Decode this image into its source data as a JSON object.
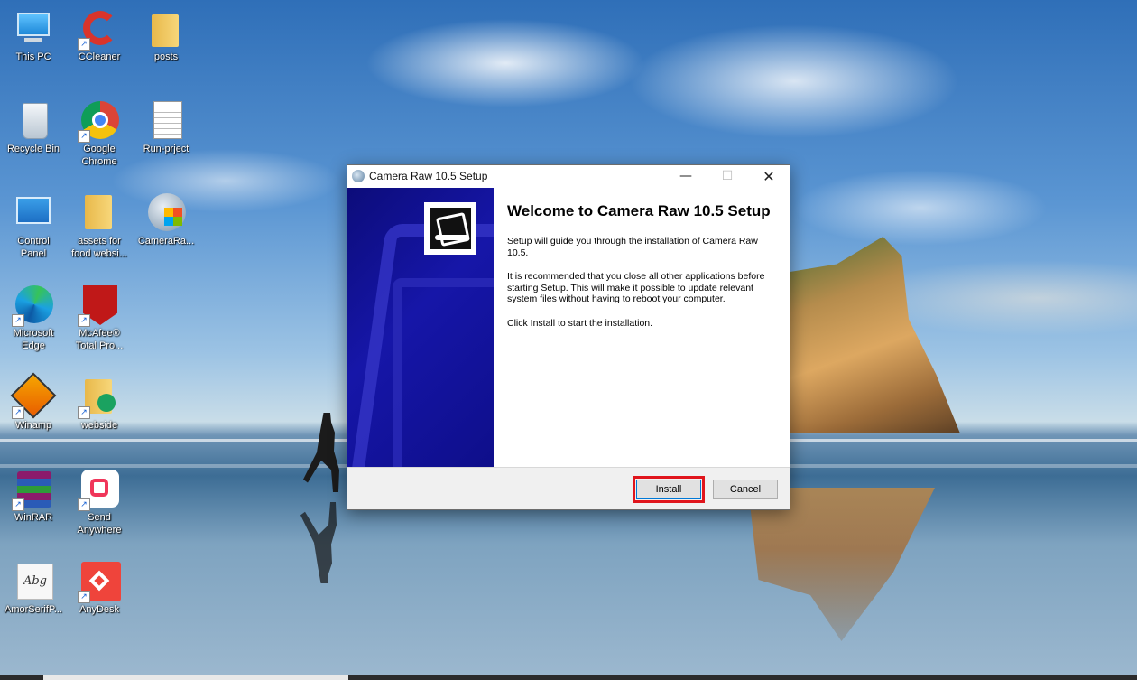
{
  "desktop": {
    "icons": [
      {
        "label": "This PC",
        "icon": "this-pc-icon"
      },
      {
        "label": "CCleaner",
        "icon": "ccleaner-icon"
      },
      {
        "label": "posts",
        "icon": "folder-icon"
      },
      {
        "label": "Recycle Bin",
        "icon": "recycle-bin-icon"
      },
      {
        "label": "Google\nChrome",
        "icon": "chrome-icon"
      },
      {
        "label": "Run-prject",
        "icon": "text-file-icon"
      },
      {
        "label": "Control\nPanel",
        "icon": "control-panel-icon"
      },
      {
        "label": "assets for\nfood websi...",
        "icon": "folder-icon"
      },
      {
        "label": "CameraRa...",
        "icon": "installer-icon"
      },
      {
        "label": "Microsoft\nEdge",
        "icon": "edge-icon"
      },
      {
        "label": "McAfee®\nTotal Pro...",
        "icon": "mcafee-icon"
      },
      {
        "label": "Winamp",
        "icon": "winamp-icon"
      },
      {
        "label": "webside",
        "icon": "folder-icon"
      },
      {
        "label": "WinRAR",
        "icon": "winrar-icon"
      },
      {
        "label": "Send\nAnywhere",
        "icon": "send-anywhere-icon"
      },
      {
        "label": "AmorSerifP...",
        "icon": "font-file-icon"
      },
      {
        "label": "AnyDesk",
        "icon": "anydesk-icon"
      }
    ]
  },
  "dialog": {
    "title": "Camera Raw 10.5 Setup",
    "minimize_glyph": "—",
    "maximize_glyph": "☐",
    "close_glyph": "✕",
    "heading": "Welcome to Camera Raw 10.5 Setup",
    "paragraphs": [
      "Setup will guide you through the installation of Camera Raw 10.5.",
      "It is recommended that you close all other applications before starting Setup. This will make it possible to update relevant system files without having to reboot your computer.",
      "Click Install to start the installation."
    ],
    "install_label": "Install",
    "cancel_label": "Cancel",
    "highlight_color": "#e0151c",
    "sidebar_color": "#0c0c7a"
  }
}
